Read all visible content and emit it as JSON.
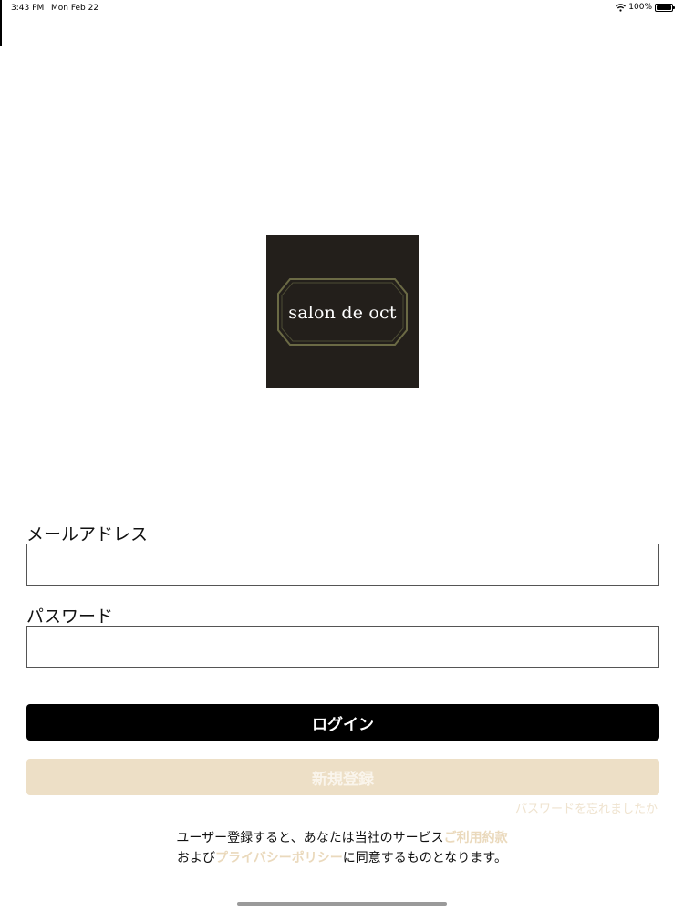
{
  "status_bar": {
    "time": "3:43 PM",
    "date": "Mon Feb 22",
    "battery": "100%",
    "battery_level": 1.0,
    "wifi_icon": "wifi-icon",
    "battery_icon": "battery-icon"
  },
  "logo": {
    "text": "salon de oct",
    "background": "#231f1b",
    "frame_color": "#6b6a45"
  },
  "form": {
    "email_label": "メールアドレス",
    "email_value": "",
    "password_label": "パスワード",
    "password_value": "",
    "login_label": "ログイン",
    "register_label": "新規登録",
    "forgot_password": "パスワードを忘れましたか"
  },
  "terms": {
    "line1_prefix": "ユーザー登録すると、あなたは当社のサービス",
    "terms_link": "ご利用約款",
    "line2_prefix": "および",
    "privacy_link": "プライバシーポリシー",
    "line2_suffix": "に同意するものとなります。"
  },
  "colors": {
    "accent_beige": "#eddfc6",
    "link_beige": "#ead9bc",
    "login_button": "#000000"
  }
}
